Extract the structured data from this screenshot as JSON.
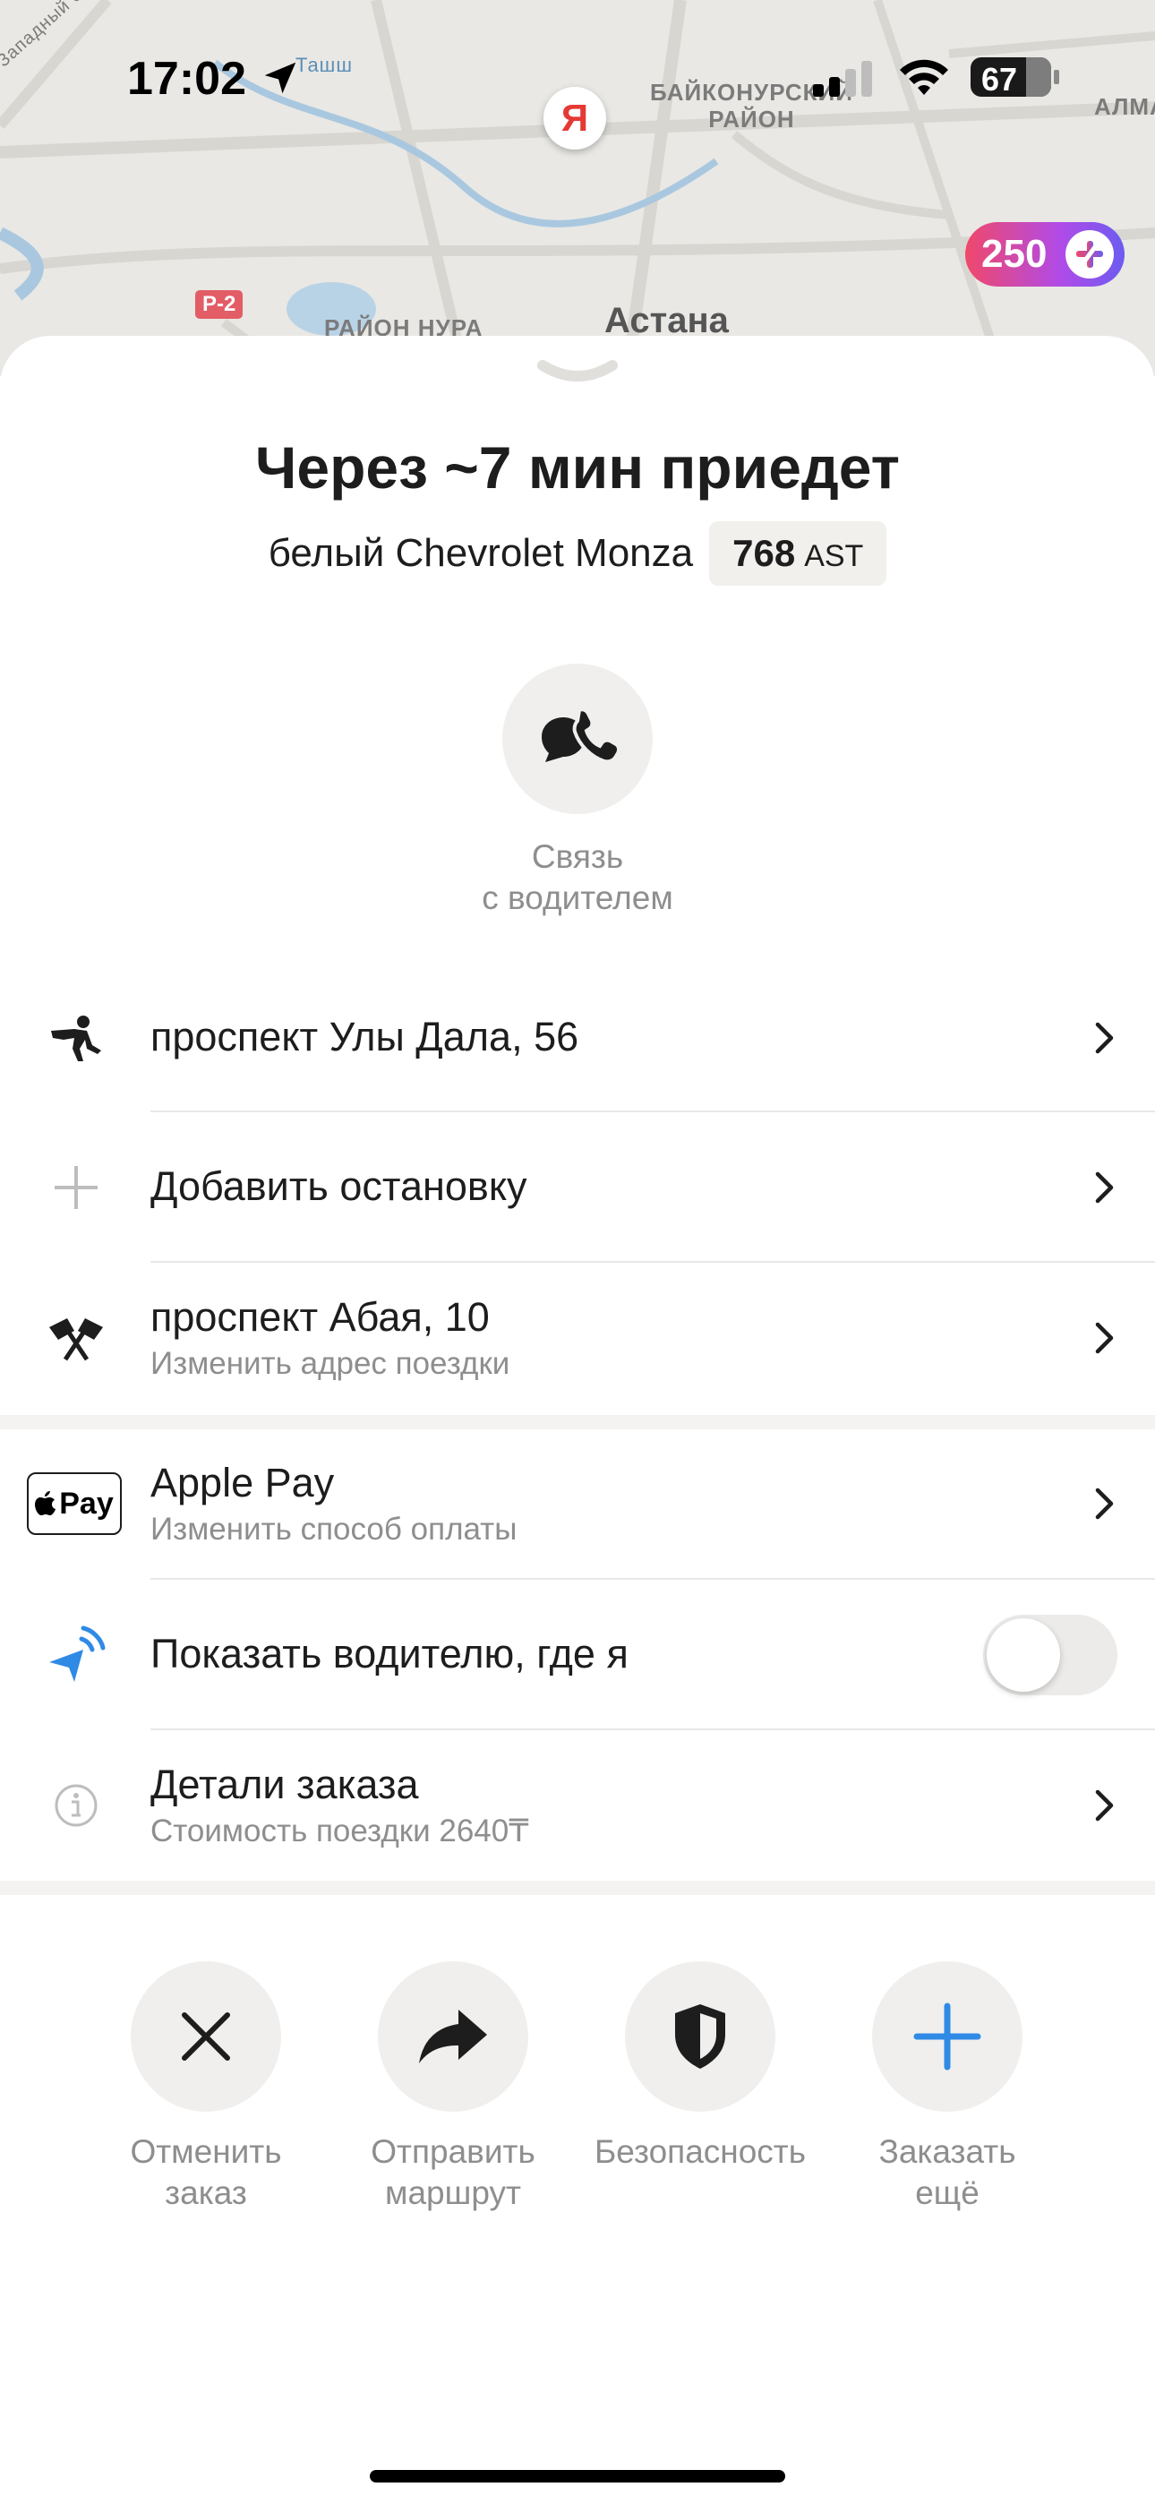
{
  "status_bar": {
    "time": "17:02",
    "battery": "67"
  },
  "map": {
    "labels": {
      "ring_road": "Западный обход А",
      "street": "Ташш",
      "district_baikonur": "БАЙКОНУРСКИЙ\nРАЙОН",
      "district_nura": "РАЙОН НУРА",
      "alma": "АЛМА",
      "city": "Астана",
      "road_badge": "Р-2",
      "pin_letter": "Я"
    }
  },
  "cashback": {
    "points": "250"
  },
  "order": {
    "title": "Через ~7 мин приедет",
    "car": "белый Chevrolet Monza",
    "plate_number": "768",
    "plate_region": "AST"
  },
  "contact": {
    "label_line1": "Связь",
    "label_line2": "с водителем"
  },
  "route": {
    "pickup": "проспект Улы Дала, 56",
    "add_stop": "Добавить остановку",
    "destination": "проспект Абая, 10",
    "destination_hint": "Изменить адрес поездки"
  },
  "payment": {
    "logo_text": "Pay",
    "method": "Apple Pay",
    "hint": "Изменить способ оплаты"
  },
  "share_location": {
    "label": "Показать водителю, где я",
    "enabled": false
  },
  "details": {
    "label": "Детали заказа",
    "hint": "Стоимость поездки 2640₸"
  },
  "actions": {
    "cancel_line1": "Отменить",
    "cancel_line2": "заказ",
    "send_line1": "Отправить",
    "send_line2": "маршрут",
    "safety": "Безопасность",
    "more_line1": "Заказать",
    "more_line2": "ещё"
  },
  "colors": {
    "accent_blue": "#2f8ae6",
    "cashback_start": "#f0486a",
    "cashback_end": "#6c5cf0"
  }
}
